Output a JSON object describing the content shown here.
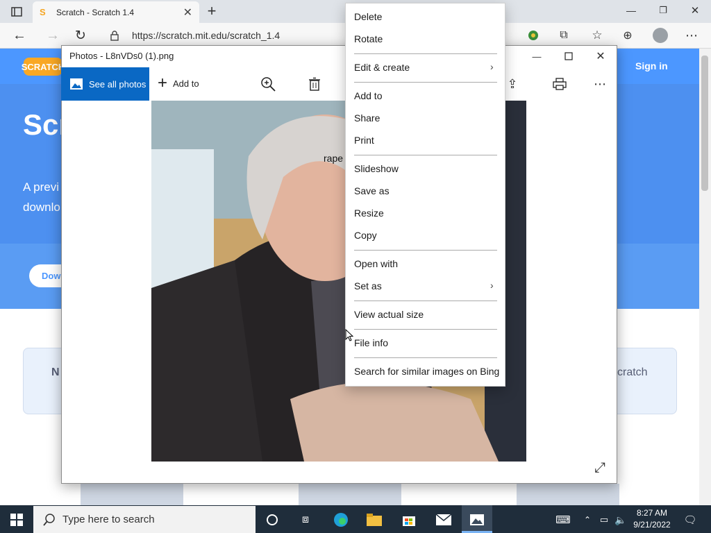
{
  "browser": {
    "tab_title": "Scratch - Scratch 1.4",
    "url": "https://scratch.mit.edu/scratch_1.4"
  },
  "scratch_page": {
    "sign_in": "Sign in",
    "hero_title": "Scr",
    "hero_line1": "A previ",
    "hero_line2": "downlo",
    "download_btn": "Dow",
    "card_left": "N",
    "card_right": "cratch"
  },
  "photos": {
    "window_title": "Photos - L8nVDs0 (1).png",
    "see_all": "See all photos",
    "add_to": "Add to",
    "overlay_text": "rape"
  },
  "context_menu": {
    "items": [
      {
        "label": "Delete"
      },
      {
        "label": "Rotate"
      },
      {
        "label": "Edit & create"
      },
      {
        "label": "Add to"
      },
      {
        "label": "Share"
      },
      {
        "label": "Print"
      },
      {
        "label": "Slideshow"
      },
      {
        "label": "Save as"
      },
      {
        "label": "Resize"
      },
      {
        "label": "Copy"
      },
      {
        "label": "Open with"
      },
      {
        "label": "Set as"
      },
      {
        "label": "View actual size"
      },
      {
        "label": "File info"
      },
      {
        "label": "Search for similar images on Bing"
      }
    ]
  },
  "taskbar": {
    "search_placeholder": "Type here to search",
    "time": "8:27 AM",
    "date": "9/21/2022"
  },
  "colors": {
    "scratch_blue": "#4c97ff",
    "photos_accent": "#0a68c4",
    "taskbar": "#1f2d3b"
  }
}
